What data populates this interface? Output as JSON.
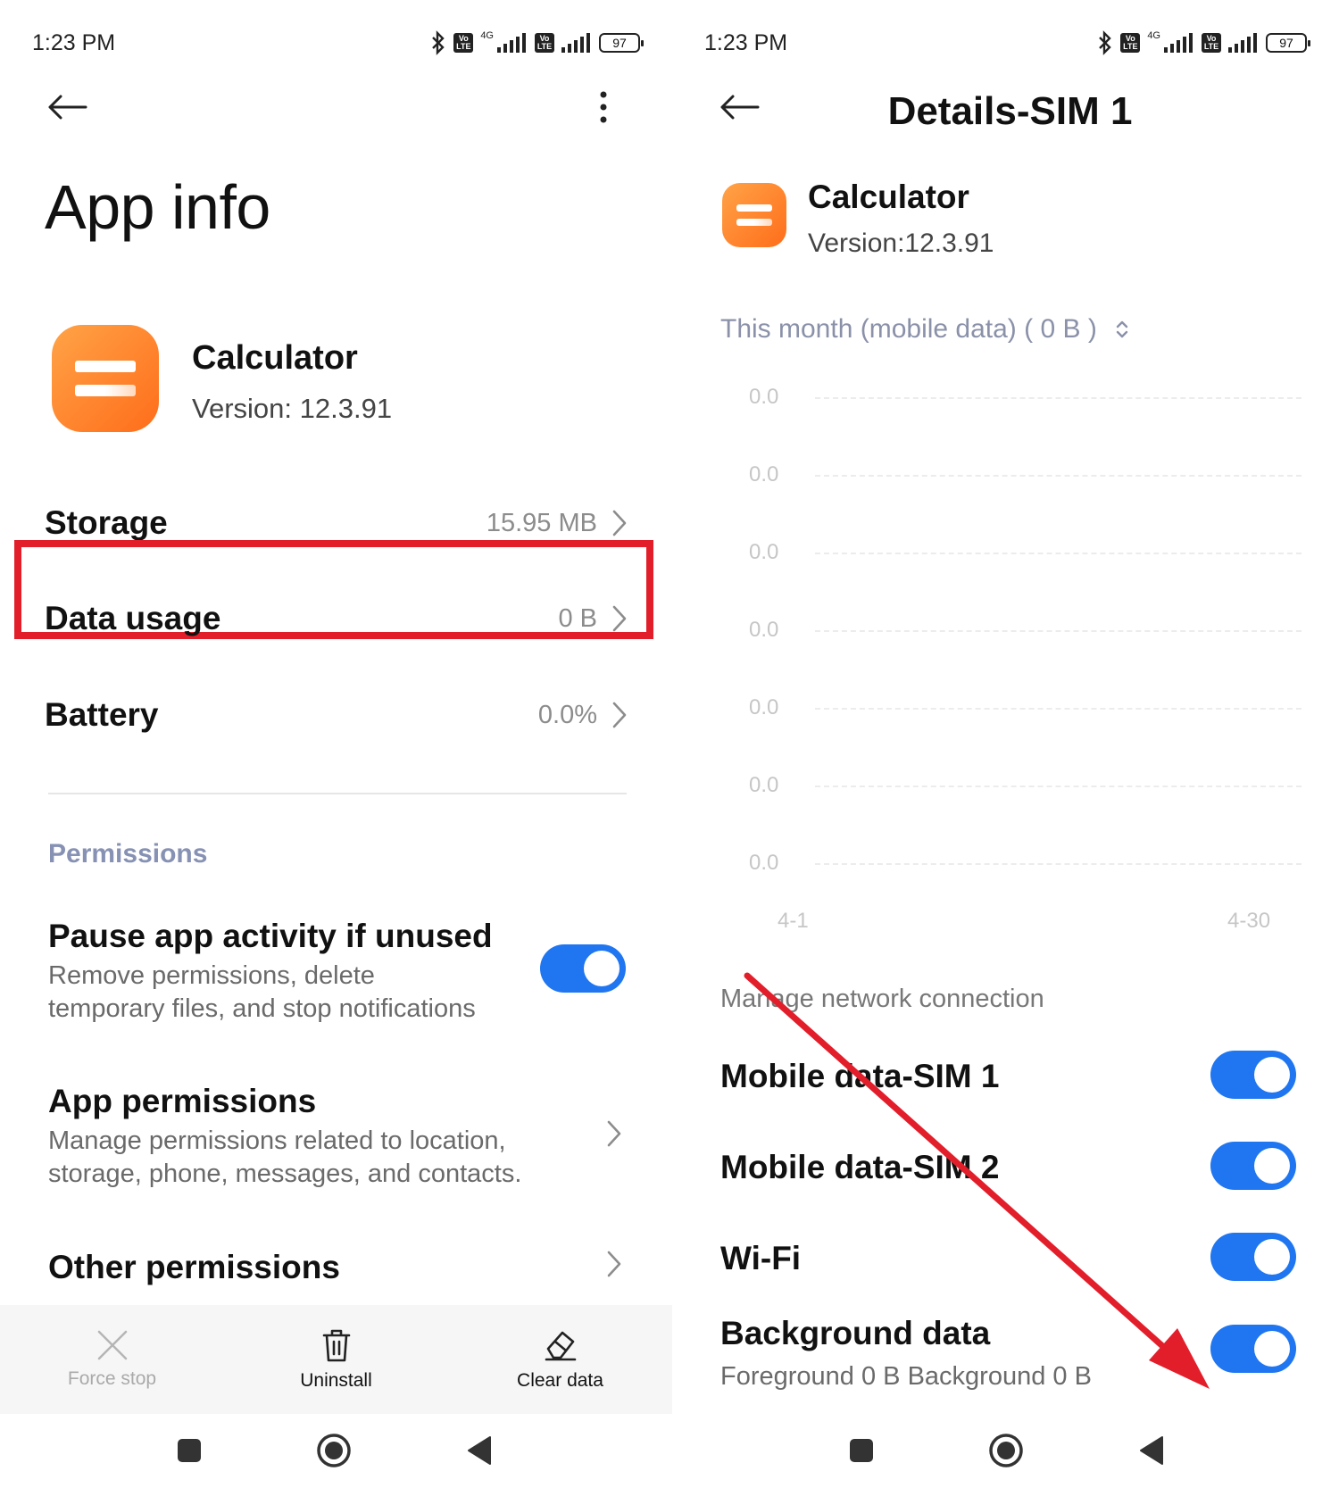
{
  "status_bar": {
    "time": "1:23 PM",
    "network_badge": "Vo LTE",
    "net_type": "4G",
    "battery": "97"
  },
  "left": {
    "page_title": "App info",
    "app": {
      "name": "Calculator",
      "version": "Version: 12.3.91"
    },
    "rows": [
      {
        "label": "Storage",
        "value": "15.95 MB"
      },
      {
        "label": "Data usage",
        "value": "0 B"
      },
      {
        "label": "Battery",
        "value": "0.0%"
      }
    ],
    "permissions_header": "Permissions",
    "pause": {
      "title": "Pause app activity if unused",
      "desc_line1": "Remove permissions, delete",
      "desc_line2": "temporary files, and stop notifications",
      "enabled": true
    },
    "app_permissions": {
      "title": "App permissions",
      "desc_line1": "Manage permissions related to location,",
      "desc_line2": "storage, phone, messages, and contacts."
    },
    "other_permissions": {
      "title": "Other permissions"
    },
    "actions": {
      "force_stop": "Force stop",
      "uninstall": "Uninstall",
      "clear_data": "Clear data"
    }
  },
  "right": {
    "title": "Details-SIM 1",
    "app": {
      "name": "Calculator",
      "version": "Version:12.3.91"
    },
    "filter_label": "This month (mobile data) ( 0 B )",
    "manage_label": "Manage network connection",
    "switches": [
      {
        "label": "Mobile data-SIM 1",
        "enabled": true
      },
      {
        "label": "Mobile data-SIM 2",
        "enabled": true
      },
      {
        "label": "Wi-Fi",
        "enabled": true
      },
      {
        "label": "Background data",
        "sub": "Foreground 0 B  Background 0 B",
        "enabled": true
      }
    ]
  },
  "colors": {
    "accent_toggle": "#1f76f0",
    "highlight_box": "#e31e2b",
    "annotation_arrow": "#e31e2b",
    "app_icon": "#ff8a2e"
  },
  "chart_data": {
    "type": "line",
    "y_tick_labels": [
      "0.0",
      "0.0",
      "0.0",
      "0.0",
      "0.0",
      "0.0",
      "0.0"
    ],
    "x_tick_labels": [
      "4-1",
      "4-30"
    ],
    "series": [],
    "grid": true
  }
}
